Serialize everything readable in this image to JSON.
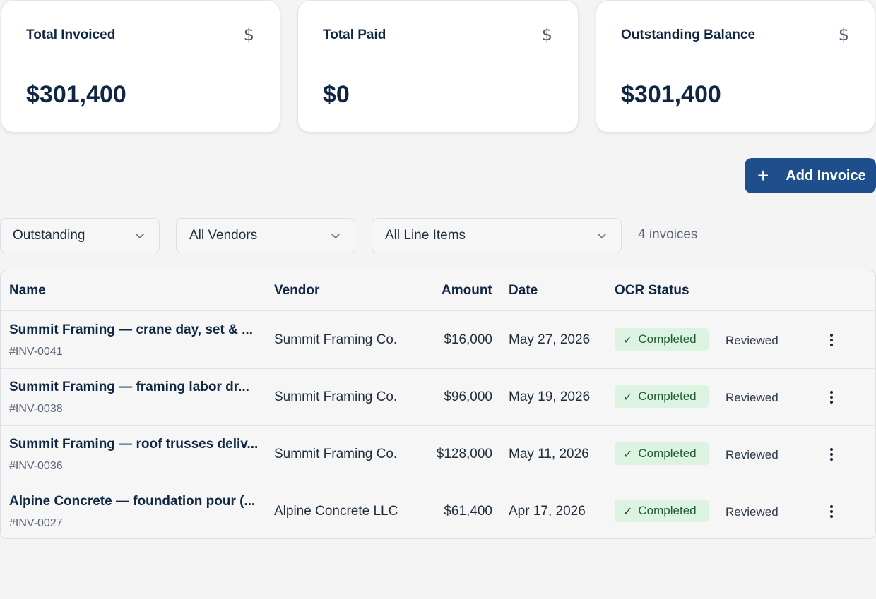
{
  "summary": {
    "total_invoiced": {
      "label": "Total Invoiced",
      "value": "$301,400",
      "icon": "dollar-icon"
    },
    "total_paid": {
      "label": "Total Paid",
      "value": "$0",
      "icon": "dollar-icon"
    },
    "outstanding": {
      "label": "Outstanding Balance",
      "value": "$301,400",
      "icon": "dollar-icon"
    }
  },
  "actions": {
    "add_invoice_label": "Add Invoice"
  },
  "filters": {
    "status": "Outstanding",
    "vendor": "All Vendors",
    "line_items": "All Line Items",
    "count_label": "4 invoices"
  },
  "table": {
    "headers": {
      "name": "Name",
      "vendor": "Vendor",
      "amount": "Amount",
      "date": "Date",
      "ocr_status": "OCR Status"
    },
    "rows": [
      {
        "name": "Summit Framing — crane day, set & ...",
        "id": "#INV-0041",
        "vendor": "Summit Framing Co.",
        "amount": "$16,000",
        "date": "May 27, 2026",
        "ocr_status": "Completed",
        "review": "Reviewed"
      },
      {
        "name": "Summit Framing — framing labor dr...",
        "id": "#INV-0038",
        "vendor": "Summit Framing Co.",
        "amount": "$96,000",
        "date": "May 19, 2026",
        "ocr_status": "Completed",
        "review": "Reviewed"
      },
      {
        "name": "Summit Framing — roof trusses deliv...",
        "id": "#INV-0036",
        "vendor": "Summit Framing Co.",
        "amount": "$128,000",
        "date": "May 11, 2026",
        "ocr_status": "Completed",
        "review": "Reviewed"
      },
      {
        "name": "Alpine Concrete — foundation pour (...",
        "id": "#INV-0027",
        "vendor": "Alpine Concrete LLC",
        "amount": "$61,400",
        "date": "Apr 17, 2026",
        "ocr_status": "Completed",
        "review": "Reviewed"
      }
    ]
  },
  "colors": {
    "primary": "#1e4f8c",
    "text": "#0f2742",
    "badge_bg": "#dcf3e2",
    "badge_text": "#1f5a34"
  }
}
